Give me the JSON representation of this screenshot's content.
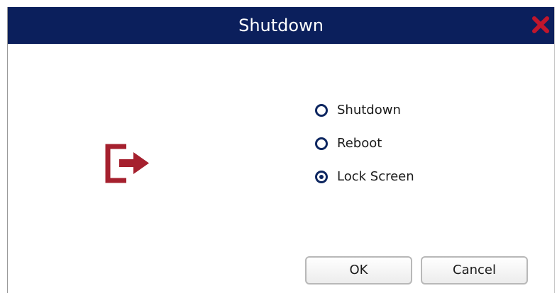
{
  "dialog": {
    "title": "Shutdown",
    "close_icon": "close-icon",
    "action_icon": "exit-icon"
  },
  "options": [
    {
      "label": "Shutdown",
      "selected": false
    },
    {
      "label": "Reboot",
      "selected": false
    },
    {
      "label": "Lock Screen",
      "selected": true
    }
  ],
  "buttons": {
    "ok_label": "OK",
    "cancel_label": "Cancel"
  },
  "colors": {
    "titlebar": "#0b1f5c",
    "close": "#c0162c",
    "exit_icon": "#a5202e",
    "radio": "#0d2660"
  }
}
